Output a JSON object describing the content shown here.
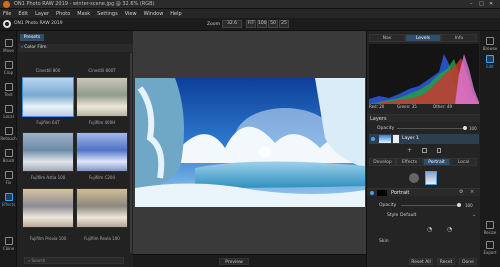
{
  "app": {
    "title": "ON1 Photo RAW 2019 - winter-scene.jpg @ 32.6% (RGB)"
  },
  "menu": [
    "File",
    "Edit",
    "Layer",
    "Photo",
    "Mask",
    "Settings",
    "View",
    "Window",
    "Help"
  ],
  "zoom": {
    "label": "Zoom",
    "value": "32.6",
    "fit": "FIT",
    "z100": "100",
    "z50": "50",
    "z25": "25"
  },
  "browser": {
    "tab": "Presets",
    "header": "Color Film",
    "thumbs": [
      {
        "label": "Cinestill 800"
      },
      {
        "label": "Cinestill 800T"
      },
      {
        "label": "Fujifilm 64T"
      },
      {
        "label": "Fujifilm 400H"
      },
      {
        "label": "Fujifilm Astia 100"
      },
      {
        "label": "Fujifilm C200"
      },
      {
        "label": "Fujifilm Provia 100"
      },
      {
        "label": "Fujifilm Reala 100"
      }
    ],
    "search_placeholder": "Search"
  },
  "tools": [
    "Move",
    "Crop",
    "Text",
    "Local",
    "Retouch",
    "Brush",
    "Fix",
    "Effects",
    "Clone"
  ],
  "tabs": {
    "nav": "Nav",
    "levels": "Levels",
    "info": "Info"
  },
  "histogram": {
    "r": "Red: 20",
    "g": "Green: 35",
    "b": "Other: 49",
    "rgb": "RGB: 21"
  },
  "layers": {
    "title": "Layers",
    "opacity_label": "Opacity",
    "opacity_value": "100",
    "layer1": "Layer 1",
    "subtabs": [
      "Develop",
      "Effects",
      "Portrait",
      "Local"
    ],
    "portrait_title": "Portrait",
    "portrait_opacity_label": "Opacity",
    "portrait_opacity_value": "100",
    "style_label": "Style",
    "style_value": "Default",
    "skin_label": "Skin"
  },
  "right_icons": [
    "Browse",
    "Edit",
    "Resize",
    "Export"
  ],
  "bottom": {
    "preview": "Preview",
    "reset_all": "Reset All",
    "reset": "Reset",
    "done": "Done"
  }
}
